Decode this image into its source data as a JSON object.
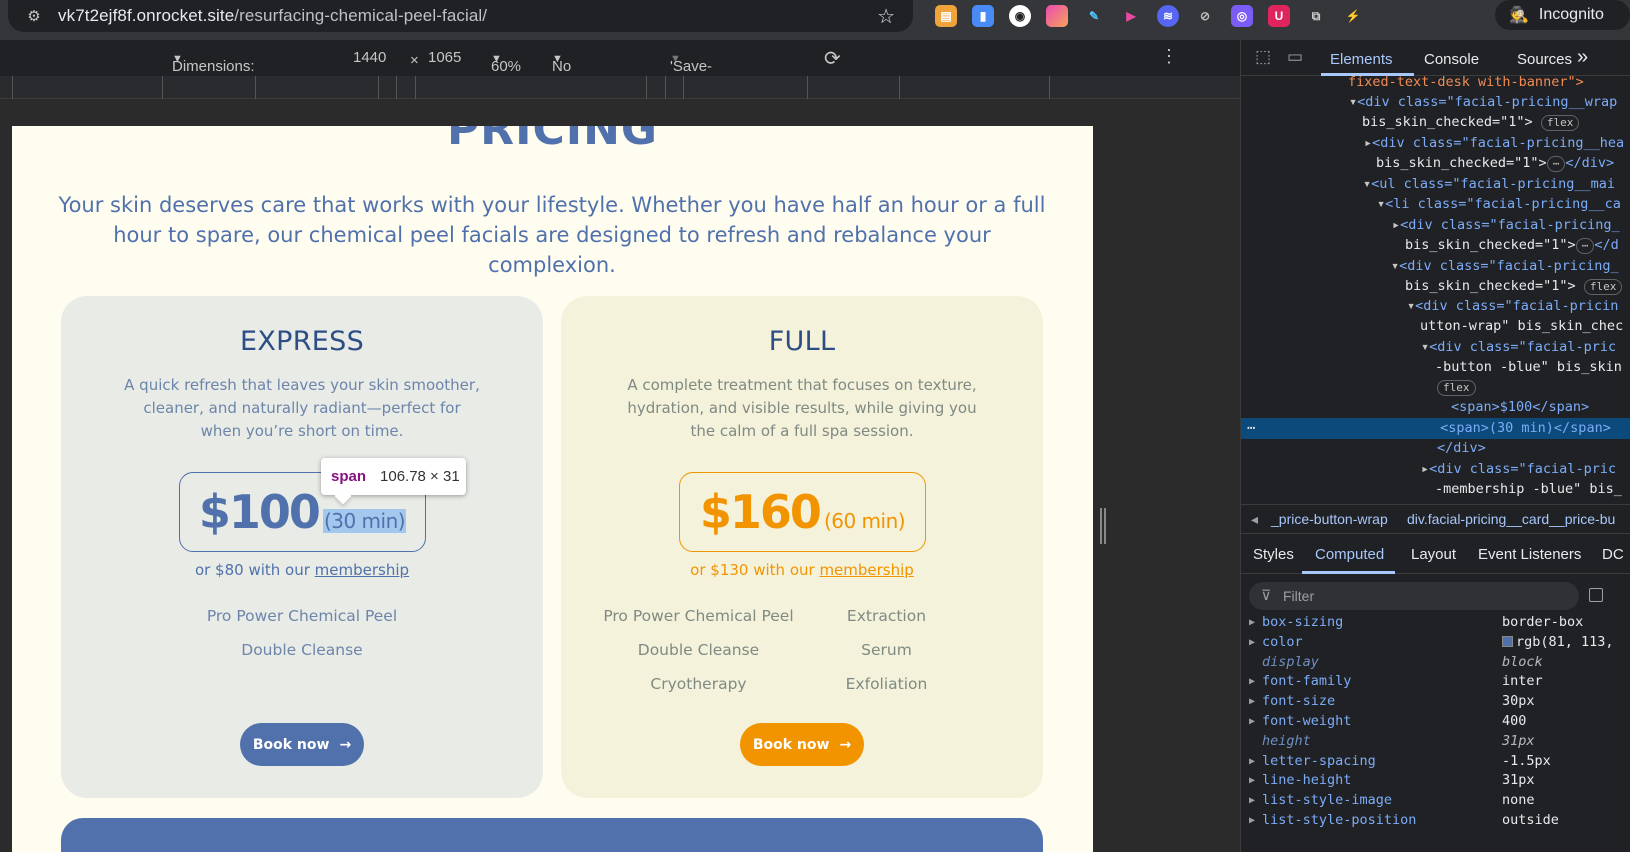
{
  "browser": {
    "url_host": "vk7t2ejf8f.onrocket.site",
    "url_path": "/resurfacing-chemical-peel-facial/",
    "incognito_label": "Incognito"
  },
  "device_toolbar": {
    "dimensions_label": "Dimensions: Responsive",
    "width": "1440",
    "times": "×",
    "height": "1065",
    "zoom": "60%",
    "throttling": "No throttling",
    "save_data": "'Save-Data': default"
  },
  "page": {
    "title": "PRICING",
    "intro": "Your skin deserves care that works with your lifestyle. Whether you have half an hour or a full hour to spare, our chemical peel facials are designed to refresh and rebalance your complexion.",
    "cards": [
      {
        "name": "EXPRESS",
        "desc": "A quick refresh that leaves your skin smoother, cleaner, and naturally radiant—perfect for when you’re short on time.",
        "price": "$100",
        "duration": "(30 min)",
        "member_prefix": "or $80 with our ",
        "member_link": "membership",
        "features": [
          "Pro Power Chemical Peel",
          "Double Cleanse"
        ],
        "book": "Book now",
        "accent": "#5071ab"
      },
      {
        "name": "FULL",
        "desc": "A complete treatment that focuses on texture, hydration, and visible results, while giving you the calm of a full spa session.",
        "price": "$160",
        "duration": "(60 min)",
        "member_prefix": "or $130 with our ",
        "member_link": "membership",
        "features_left": [
          "Pro Power Chemical Peel",
          "Double Cleanse",
          "Cryotherapy"
        ],
        "features_right": [
          "Extraction",
          "Serum",
          "Exfoliation"
        ],
        "book": "Book now",
        "accent": "#f29400"
      }
    ]
  },
  "inspect_tooltip": {
    "tag": "span",
    "size": "106.78 × 31"
  },
  "devtools": {
    "tabs": [
      "Elements",
      "Console",
      "Sources"
    ],
    "more": "»",
    "dom": [
      "fixed-text-desk with-banner\">",
      "<div class=\"facial-pricing__wrap",
      "bis_skin_checked=\"1\">",
      "<div class=\"facial-pricing__hea",
      "bis_skin_checked=\"1\">",
      "<ul class=\"facial-pricing__mai",
      "<li class=\"facial-pricing__ca",
      "<div class=\"facial-pricing_",
      "bis_skin_checked=\"1\">",
      "<div class=\"facial-pricing_",
      "bis_skin_checked=\"1\">",
      "<div class=\"facial-pricin",
      "utton-wrap\" bis_skin_chec",
      "<div class=\"facial-pric",
      "-button -blue\" bis_skin",
      "flex",
      "<span>$100</span>",
      "<span>(30 min)</span>",
      "</div>",
      "<div class=\"facial-pric",
      "-membership -blue\" bis_"
    ],
    "breadcrumbs": [
      "_price-button-wrap",
      "div.facial-pricing__card__price-bu"
    ],
    "subtabs": [
      "Styles",
      "Computed",
      "Layout",
      "Event Listeners",
      "DC"
    ],
    "filter_placeholder": "Filter",
    "computed": [
      {
        "prop": "box-sizing",
        "value": "border-box",
        "inherited": false
      },
      {
        "prop": "color",
        "value": "rgb(81, 113,",
        "inherited": false
      },
      {
        "prop": "display",
        "value": "block",
        "inherited": true
      },
      {
        "prop": "font-family",
        "value": "inter",
        "inherited": false
      },
      {
        "prop": "font-size",
        "value": "30px",
        "inherited": false
      },
      {
        "prop": "font-weight",
        "value": "400",
        "inherited": false
      },
      {
        "prop": "height",
        "value": "31px",
        "inherited": true
      },
      {
        "prop": "letter-spacing",
        "value": "-1.5px",
        "inherited": false
      },
      {
        "prop": "line-height",
        "value": "31px",
        "inherited": false
      },
      {
        "prop": "list-style-image",
        "value": "none",
        "inherited": false
      },
      {
        "prop": "list-style-position",
        "value": "outside",
        "inherited": false
      }
    ]
  }
}
